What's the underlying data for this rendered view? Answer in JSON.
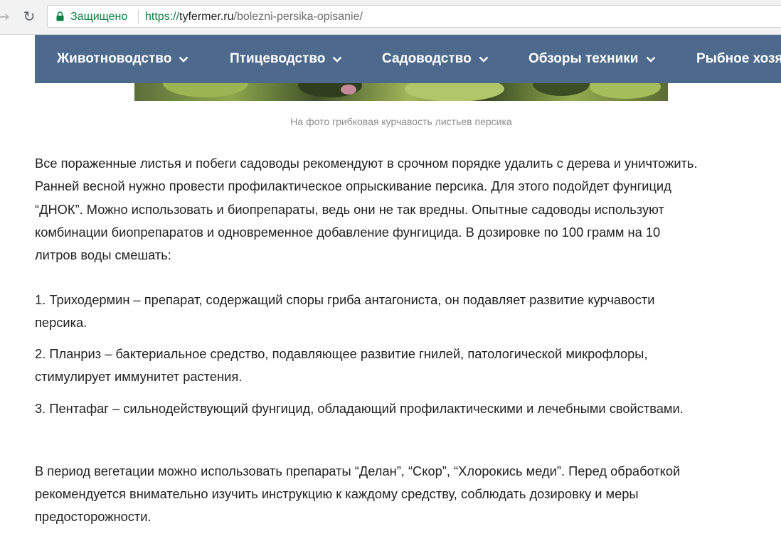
{
  "browser": {
    "secure_label": "Защищено",
    "url_scheme": "https://",
    "url_host": "tyfermer.ru",
    "url_path": "/bolezni-persika-opisanie/"
  },
  "nav": {
    "items": [
      {
        "label": "Животноводство"
      },
      {
        "label": "Птицеводство"
      },
      {
        "label": "Садоводство"
      },
      {
        "label": "Обзоры техники"
      },
      {
        "label": "Рыбное хозя"
      }
    ]
  },
  "photo": {
    "caption": "На фото грибковая курчавость листьев персика"
  },
  "article": {
    "para1": [
      "Все пораженные листья и побеги садоводы рекомендуют в срочном порядке удалить с дерева и уничтожить.",
      "Ранней весной нужно провести профилактическое опрыскивание персика. Для этого подойдет фунгицид",
      "“ДНОК”. Можно использовать и биопрепараты, ведь они не так вредны. Опытные садоводы используют",
      "комбинации биопрепаратов и одновременное добавление фунгицида. В дозировке по 100 грамм на 10",
      "литров воды смешать:"
    ],
    "list": [
      [
        "1. Триходермин – препарат, содержащий споры гриба антагониста, он подавляет развитие курчавости",
        "персика."
      ],
      [
        "2. Планриз – бактериальное средство, подавляющее развитие гнилей, патологической микрофлоры,",
        "стимулирует иммунитет растения."
      ],
      [
        "3. Пентафаг – сильнодействующий фунгицид, обладающий профилактическими и лечебными свойствами."
      ]
    ],
    "para2": [
      "В период вегетации можно использовать препараты “Делан”, “Скор”, “Хлорокись меди”. Перед обработкой",
      "рекомендуется внимательно изучить инструкцию к каждому средству, соблюдать дозировку и меры",
      "предосторожности."
    ]
  },
  "colors": {
    "nav_background": "#4d6a8c",
    "secure_green": "#0b8043",
    "body_text": "#222222",
    "caption_text": "#8c8c8c"
  }
}
